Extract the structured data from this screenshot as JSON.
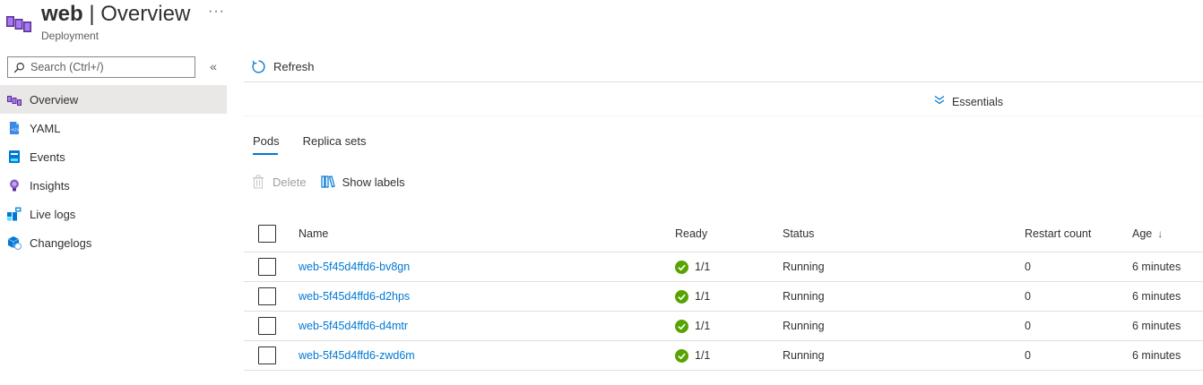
{
  "header": {
    "resource_name": "web",
    "separator": "|",
    "page": "Overview",
    "more": "···",
    "resource_type": "Deployment",
    "icon": "kubernetes-deployment-icon"
  },
  "sidebar": {
    "search_placeholder": "Search (Ctrl+/)",
    "collapse": "«",
    "items": [
      {
        "label": "Overview",
        "icon": "overview-icon",
        "active": true
      },
      {
        "label": "YAML",
        "icon": "yaml-icon",
        "active": false
      },
      {
        "label": "Events",
        "icon": "events-icon",
        "active": false
      },
      {
        "label": "Insights",
        "icon": "insights-icon",
        "active": false
      },
      {
        "label": "Live logs",
        "icon": "live-logs-icon",
        "active": false
      },
      {
        "label": "Changelogs",
        "icon": "changelogs-icon",
        "active": false
      }
    ]
  },
  "commandbar": {
    "refresh": "Refresh"
  },
  "essentials": {
    "label": "Essentials",
    "chevron": "⌄"
  },
  "tabs": [
    {
      "label": "Pods",
      "active": true
    },
    {
      "label": "Replica sets",
      "active": false
    }
  ],
  "toolbar": {
    "delete": "Delete",
    "show_labels": "Show labels"
  },
  "table": {
    "columns": {
      "name": "Name",
      "ready": "Ready",
      "status": "Status",
      "restart_count": "Restart count",
      "age": "Age",
      "age_sort": "↓"
    },
    "rows": [
      {
        "name": "web-5f45d4ffd6-bv8gn",
        "ready": "1/1",
        "status": "Running",
        "restart_count": "0",
        "age": "6 minutes"
      },
      {
        "name": "web-5f45d4ffd6-d2hps",
        "ready": "1/1",
        "status": "Running",
        "restart_count": "0",
        "age": "6 minutes"
      },
      {
        "name": "web-5f45d4ffd6-d4mtr",
        "ready": "1/1",
        "status": "Running",
        "restart_count": "0",
        "age": "6 minutes"
      },
      {
        "name": "web-5f45d4ffd6-zwd6m",
        "ready": "1/1",
        "status": "Running",
        "restart_count": "0",
        "age": "6 minutes"
      }
    ]
  },
  "colors": {
    "accent": "#0078d4",
    "success": "#57a300",
    "resource_purple": "#773adc"
  }
}
